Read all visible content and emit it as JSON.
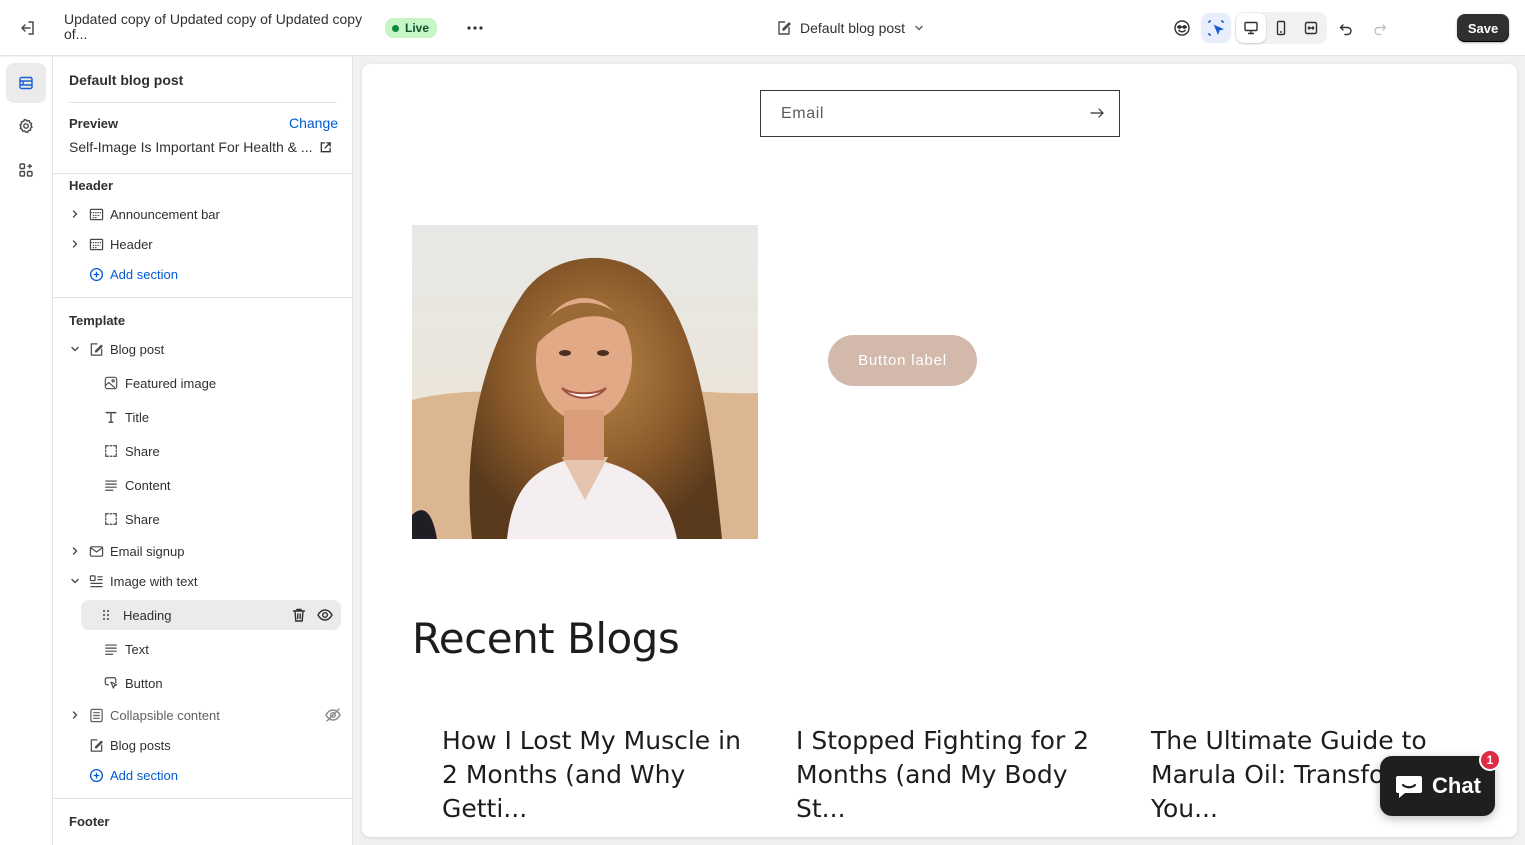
{
  "topbar": {
    "title": "Updated copy of Updated copy of Updated copy of...",
    "status": "Live",
    "template_name": "Default blog post",
    "save_label": "Save",
    "icons": {
      "exit": "exit-icon",
      "more": "more-horizontal-icon",
      "template": "page-edit-icon",
      "chevron": "chevron-down-icon",
      "inspector": "ai-inspector-icon",
      "select": "cursor-select-icon",
      "desktop": "desktop-icon",
      "mobile": "mobile-icon",
      "fullwidth": "full-width-icon",
      "undo": "undo-icon",
      "redo": "redo-icon"
    }
  },
  "rail": {
    "items": [
      {
        "name": "sections",
        "icon": "sections-icon",
        "active": true
      },
      {
        "name": "settings",
        "icon": "gear-icon",
        "active": false
      },
      {
        "name": "apps",
        "icon": "apps-icon",
        "active": false
      }
    ]
  },
  "panel": {
    "heading": "Default blog post",
    "preview_label": "Preview",
    "change_label": "Change",
    "preview_value": "Self-Image Is Important For Health & ...",
    "header_group": "Header",
    "header_items": [
      "Announcement bar",
      "Header"
    ],
    "add_section": "Add section",
    "template_group": "Template",
    "blog_post": "Blog post",
    "blog_post_blocks": [
      "Featured image",
      "Title",
      "Share",
      "Content",
      "Share"
    ],
    "email_signup": "Email signup",
    "image_with_text": "Image with text",
    "iwt_blocks": [
      "Heading",
      "Text",
      "Button"
    ],
    "collapsible": "Collapsible content",
    "blog_posts": "Blog posts",
    "footer_group": "Footer"
  },
  "canvas": {
    "email_placeholder": "Email",
    "button_label": "Button label",
    "recent_title": "Recent Blogs",
    "cards": [
      "How I Lost My Muscle in 2 Months (and Why Getti...",
      "I Stopped Fighting for 2 Months (and My Body St...",
      "The Ultimate Guide to Marula Oil: Transfor You..."
    ]
  },
  "chat": {
    "label": "Chat",
    "badge": "1"
  },
  "colors": {
    "accent": "#005bd3",
    "button_bg": "#d3b9ac",
    "live_bg": "#c7f5c6",
    "save_bg": "#303030"
  }
}
